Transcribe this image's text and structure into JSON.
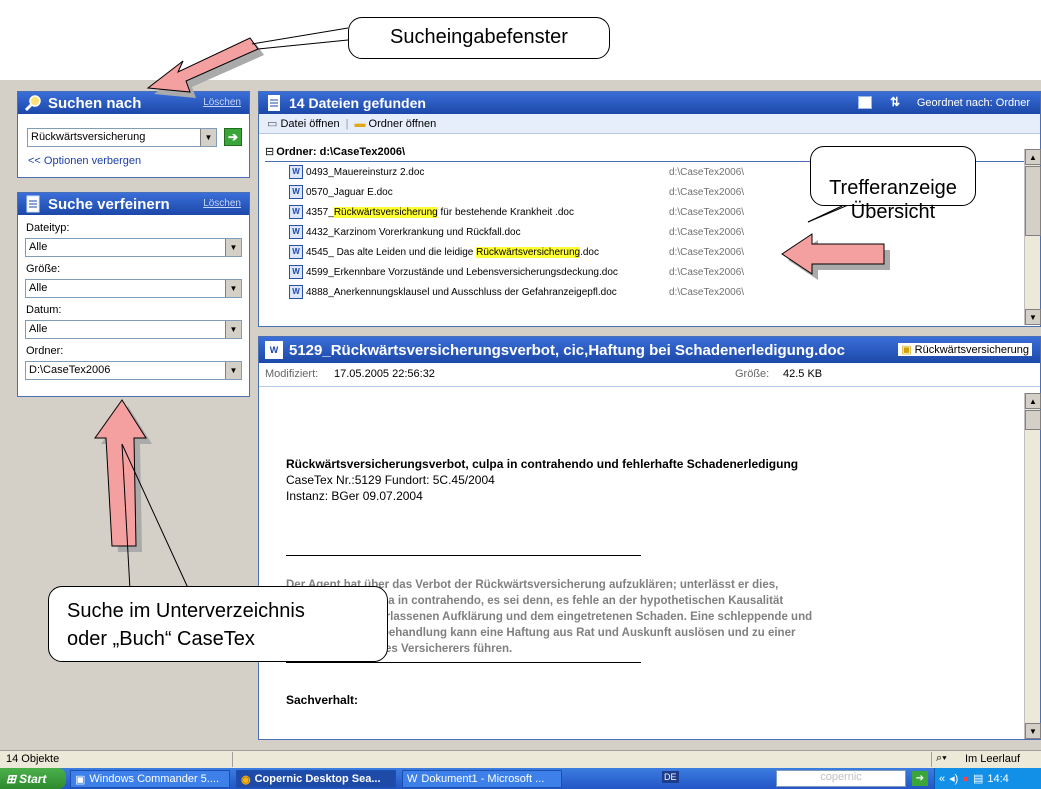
{
  "search_panel": {
    "title": "Suchen nach",
    "clear": "Löschen",
    "query": "Rückwärtsversicherung",
    "options_link": "<< Optionen verbergen"
  },
  "refine_panel": {
    "title": "Suche verfeinern",
    "clear": "Löschen",
    "filetype_label": "Dateityp:",
    "filetype_value": "Alle",
    "size_label": "Größe:",
    "size_value": "Alle",
    "date_label": "Datum:",
    "date_value": "Alle",
    "folder_label": "Ordner:",
    "folder_value": "D:\\CaseTex2006"
  },
  "results": {
    "title": "14 Dateien gefunden",
    "sort_label": "Geordnet nach: Ordner",
    "open_file": "Datei öffnen",
    "open_folder": "Ordner öffnen",
    "group": "Ordner: d:\\CaseTex2006\\",
    "rows": [
      {
        "pre": "0493_Mauereinsturz 2.doc",
        "hl": "",
        "post": "",
        "path": "d:\\CaseTex2006\\"
      },
      {
        "pre": "0570_Jaguar E.doc",
        "hl": "",
        "post": "",
        "path": "d:\\CaseTex2006\\"
      },
      {
        "pre": "4357_",
        "hl": "Rückwärtsversicherung",
        "post": " für bestehende Krankheit  .doc",
        "path": "d:\\CaseTex2006\\"
      },
      {
        "pre": "4432_Karzinom  Vorerkrankung und Rückfall.doc",
        "hl": "",
        "post": "",
        "path": "d:\\CaseTex2006\\"
      },
      {
        "pre": "4545_ Das alte Leiden  und die leidige ",
        "hl": "Rückwärtsversicherung",
        "post": ".doc",
        "path": "d:\\CaseTex2006\\"
      },
      {
        "pre": "4599_Erkennbare Vorzustände und Lebensversicherungsdeckung.doc",
        "hl": "",
        "post": "",
        "path": "d:\\CaseTex2006\\"
      },
      {
        "pre": "4888_Anerkennungsklausel und Ausschluss der Gefahranzeigepfl.doc",
        "hl": "",
        "post": "",
        "path": "d:\\CaseTex2006\\"
      }
    ]
  },
  "preview": {
    "title": "5129_Rückwärtsversicherungsverbot, cic,Haftung bei Schadenerledigung.doc",
    "keyword": "Rückwärtsversicherung",
    "modified_label": "Modifiziert:",
    "modified_value": "17.05.2005 22:56:32",
    "size_label": "Größe:",
    "size_value": "42.5 KB",
    "doc_heading": "Rückwärtsversicherungsverbot, culpa in contrahendo und fehlerhafte Schadenerledigung",
    "doc_line1": "CaseTex Nr.:5129 Fundort: 5C.45/2004",
    "doc_line2": "Instanz: BGer 09.07.2004",
    "para_lines": [
      "Der Agent hat über das Verbot der Rückwärtsversicherung aufzuklären; unterlässt er dies,",
      "haftet er nach culpa in contrahendo, es sei denn, es fehle an der hypothetischen Kausalität",
      "zwischen der unterlassenen Aufklärung und dem eingetretenen Schaden. Eine schleppende und",
      "unsorgfältige Fallbehandlung kann eine Haftung aus Rat und Auskunft auslösen und zu einer",
      "Leistungspflicht des Versicherers führen."
    ],
    "section": "Sachverhalt:"
  },
  "status": {
    "count": "14 Objekte",
    "state": "Im Leerlauf"
  },
  "taskbar": {
    "start": "Start",
    "items": [
      "Windows Commander 5....",
      "Copernic Desktop Sea...",
      "Dokument1 - Microsoft ...",
      "DE"
    ],
    "search_hint": "copernic",
    "clock": "14:4"
  },
  "callouts": {
    "top": "Sucheingabefenster",
    "right": "Trefferanzeige\nÜbersicht",
    "left_line1": "Suche im Unterverzeichnis",
    "left_line2": "oder „Buch“ CaseTex"
  }
}
